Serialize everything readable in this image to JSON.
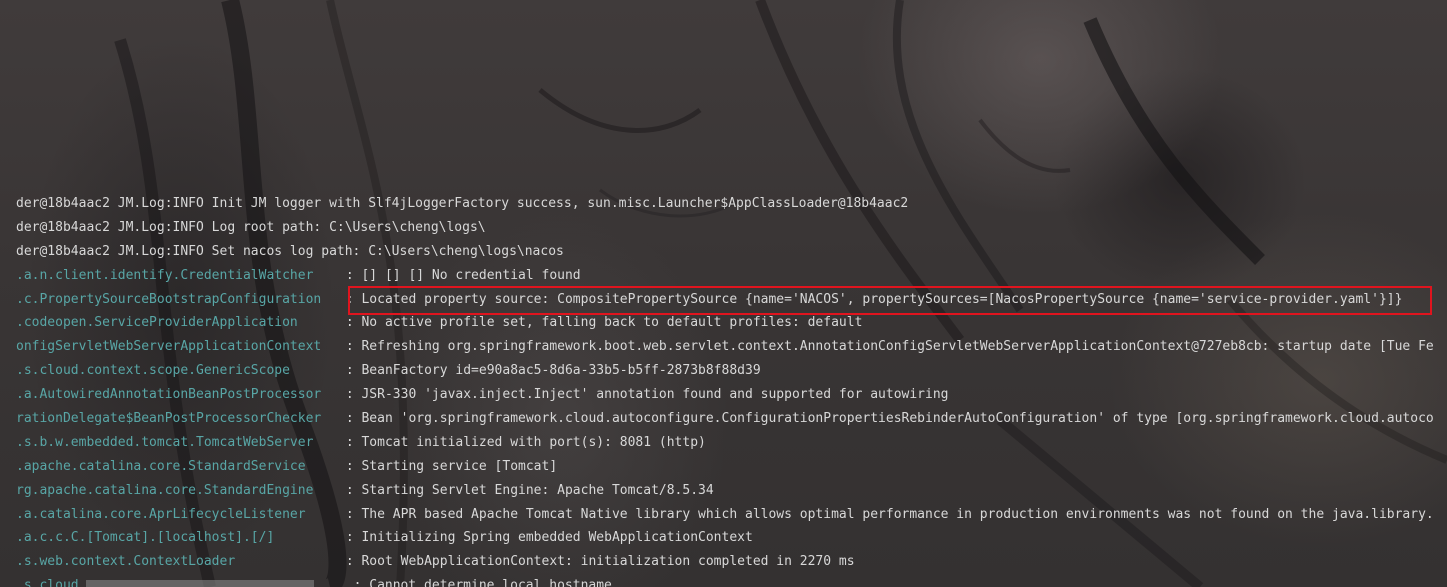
{
  "console": {
    "lines": [
      {
        "logger": "",
        "message": "der@18b4aac2 JM.Log:INFO Init JM logger with Slf4jLoggerFactory success, sun.misc.Launcher$AppClassLoader@18b4aac2"
      },
      {
        "logger": "",
        "message": "der@18b4aac2 JM.Log:INFO Log root path: C:\\Users\\cheng\\logs\\"
      },
      {
        "logger": "",
        "message": "der@18b4aac2 JM.Log:INFO Set nacos log path: C:\\Users\\cheng\\logs\\nacos"
      },
      {
        "logger": ".a.n.client.identify.CredentialWatcher",
        "message": "[] [] [] No credential found"
      },
      {
        "logger": ".c.PropertySourceBootstrapConfiguration",
        "message": "Located property source: CompositePropertySource {name='NACOS', propertySources=[NacosPropertySource {name='service-provider.yaml'}]}"
      },
      {
        "logger": ".codeopen.ServiceProviderApplication",
        "message": "No active profile set, falling back to default profiles: default"
      },
      {
        "logger": "onfigServletWebServerApplicationContext",
        "message": "Refreshing org.springframework.boot.web.servlet.context.AnnotationConfigServletWebServerApplicationContext@727eb8cb: startup date [Tue Fe"
      },
      {
        "logger": ".s.cloud.context.scope.GenericScope",
        "message": "BeanFactory id=e90a8ac5-8d6a-33b5-b5ff-2873b8f88d39"
      },
      {
        "logger": ".a.AutowiredAnnotationBeanPostProcessor",
        "message": "JSR-330 'javax.inject.Inject' annotation found and supported for autowiring"
      },
      {
        "logger": "rationDelegate$BeanPostProcessorChecker",
        "message": "Bean 'org.springframework.cloud.autoconfigure.ConfigurationPropertiesRebinderAutoConfiguration' of type [org.springframework.cloud.autoco"
      },
      {
        "logger": ".s.b.w.embedded.tomcat.TomcatWebServer",
        "message": "Tomcat initialized with port(s): 8081 (http)"
      },
      {
        "logger": ".apache.catalina.core.StandardService",
        "message": "Starting service [Tomcat]"
      },
      {
        "logger": "rg.apache.catalina.core.StandardEngine",
        "message": "Starting Servlet Engine: Apache Tomcat/8.5.34"
      },
      {
        "logger": ".a.catalina.core.AprLifecycleListener",
        "message": "The APR based Apache Tomcat Native library which allows optimal performance in production environments was not found on the java.library."
      },
      {
        "logger": ".a.c.c.C.[Tomcat].[localhost].[/]",
        "message": "Initializing Spring embedded WebApplicationContext"
      },
      {
        "logger": ".s.web.context.ContextLoader",
        "message": "Root WebApplicationContext: initialization completed in 2270 ms"
      },
      {
        "logger": ".s.cloud.",
        "message": "Cannot determine local hostname"
      }
    ],
    "highlighted_line_index": 4
  },
  "colors": {
    "logger": "#58a6a6",
    "text": "#d8d8d8",
    "highlight_border": "#e0141e"
  }
}
